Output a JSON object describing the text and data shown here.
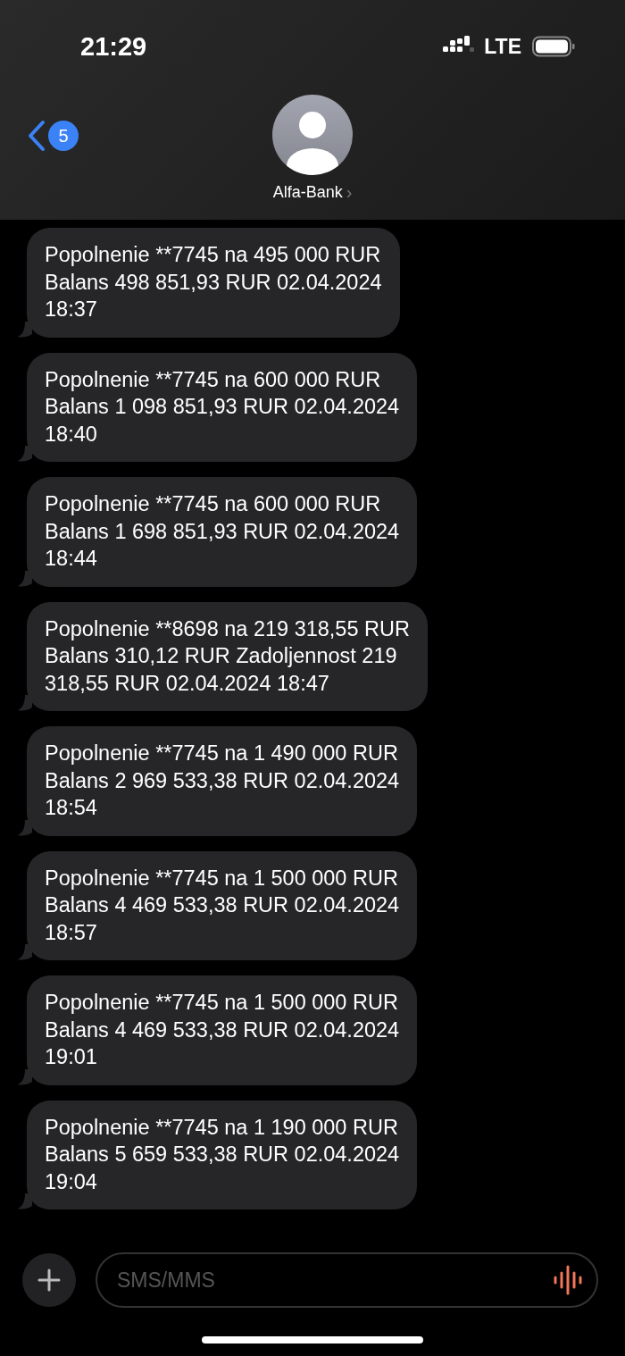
{
  "status_bar": {
    "time": "21:29",
    "network": "LTE"
  },
  "header": {
    "back_badge": "5",
    "contact": "Alfa-Bank",
    "chevron": "›"
  },
  "messages": [
    {
      "text": "Popolnenie **7745 na 495 000 RUR\nBalans 498 851,93 RUR 02.04.2024\n18:37"
    },
    {
      "text": "Popolnenie **7745 na 600 000 RUR\nBalans 1 098 851,93 RUR 02.04.2024\n18:40"
    },
    {
      "text": "Popolnenie **7745 na 600 000 RUR\nBalans 1 698 851,93 RUR 02.04.2024\n18:44"
    },
    {
      "text": "Popolnenie **8698 na 219 318,55 RUR\nBalans 310,12 RUR Zadoljennost 219\n318,55 RUR 02.04.2024 18:47"
    },
    {
      "text": "Popolnenie **7745 na 1 490 000 RUR\nBalans 2 969 533,38 RUR 02.04.2024\n18:54"
    },
    {
      "text": "Popolnenie **7745 na 1 500 000 RUR\nBalans 4 469 533,38 RUR 02.04.2024\n18:57"
    },
    {
      "text": "Popolnenie **7745 na 1 500 000 RUR\nBalans 4 469 533,38 RUR 02.04.2024\n19:01"
    },
    {
      "text": "Popolnenie **7745 na 1 190 000 RUR\nBalans 5 659 533,38 RUR 02.04.2024\n19:04"
    }
  ],
  "composer": {
    "placeholder": "SMS/MMS"
  }
}
